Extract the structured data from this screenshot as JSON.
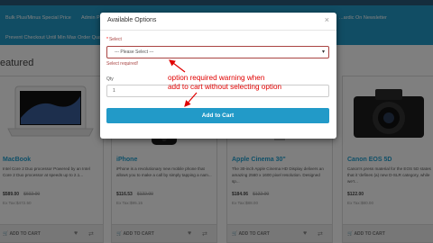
{
  "header": {
    "menu": [
      "Bulk Plus/Minus Special Price",
      "Admin P",
      "Prevent Checkout Until Min Max Order Quantity",
      "...ardic On Newsletter"
    ]
  },
  "section_title": "eatured",
  "products": [
    {
      "name": "MacBook",
      "desc": "Intel Core 2 Duo processor Powered by an Intel Core 2 Duo processor at speeds up to 2.1...",
      "price": "$589.00",
      "old_price": "$602.00",
      "extax": "Ex Tax:$472.50",
      "add_label": "ADD TO CART"
    },
    {
      "name": "iPhone",
      "desc": "iPhone is a revolutionary new mobile phone that allows you to make a call by simply tapping a nam...",
      "price": "$116.53",
      "old_price": "$122.00",
      "extax": "Ex Tax:$95.15",
      "add_label": "ADD TO CART"
    },
    {
      "name": "Apple Cinema 30\"",
      "desc": "The 30-inch Apple Cinema HD Display delivers an amazing 2560 x 1600 pixel resolution. Designed sp...",
      "price": "$184.06",
      "old_price": "$122.00",
      "extax": "Ex Tax:$88.00",
      "add_label": "ADD TO CART"
    },
    {
      "name": "Canon EOS 5D",
      "desc": "Canon's press material for the EOS 5D states that it 'defines (a) new D-SLR category, while we'r...",
      "price": "$122.00",
      "old_price": "",
      "extax": "Ex Tax:$80.00",
      "add_label": "ADD TO CART"
    }
  ],
  "modal": {
    "title": "Available Options",
    "close": "×",
    "select_label": "Select",
    "required_mark": "*",
    "select_value": " --- Please Select --- ",
    "error": "Select required!",
    "qty_label": "Qty",
    "qty_value": "1",
    "add_to_cart": "Add to Cart"
  },
  "annotation": {
    "line1": "option required warning when",
    "line2": "add to cart without selecting option",
    "color": "#e00000"
  },
  "colors": {
    "brand": "#229ac8",
    "error": "#a94442"
  }
}
